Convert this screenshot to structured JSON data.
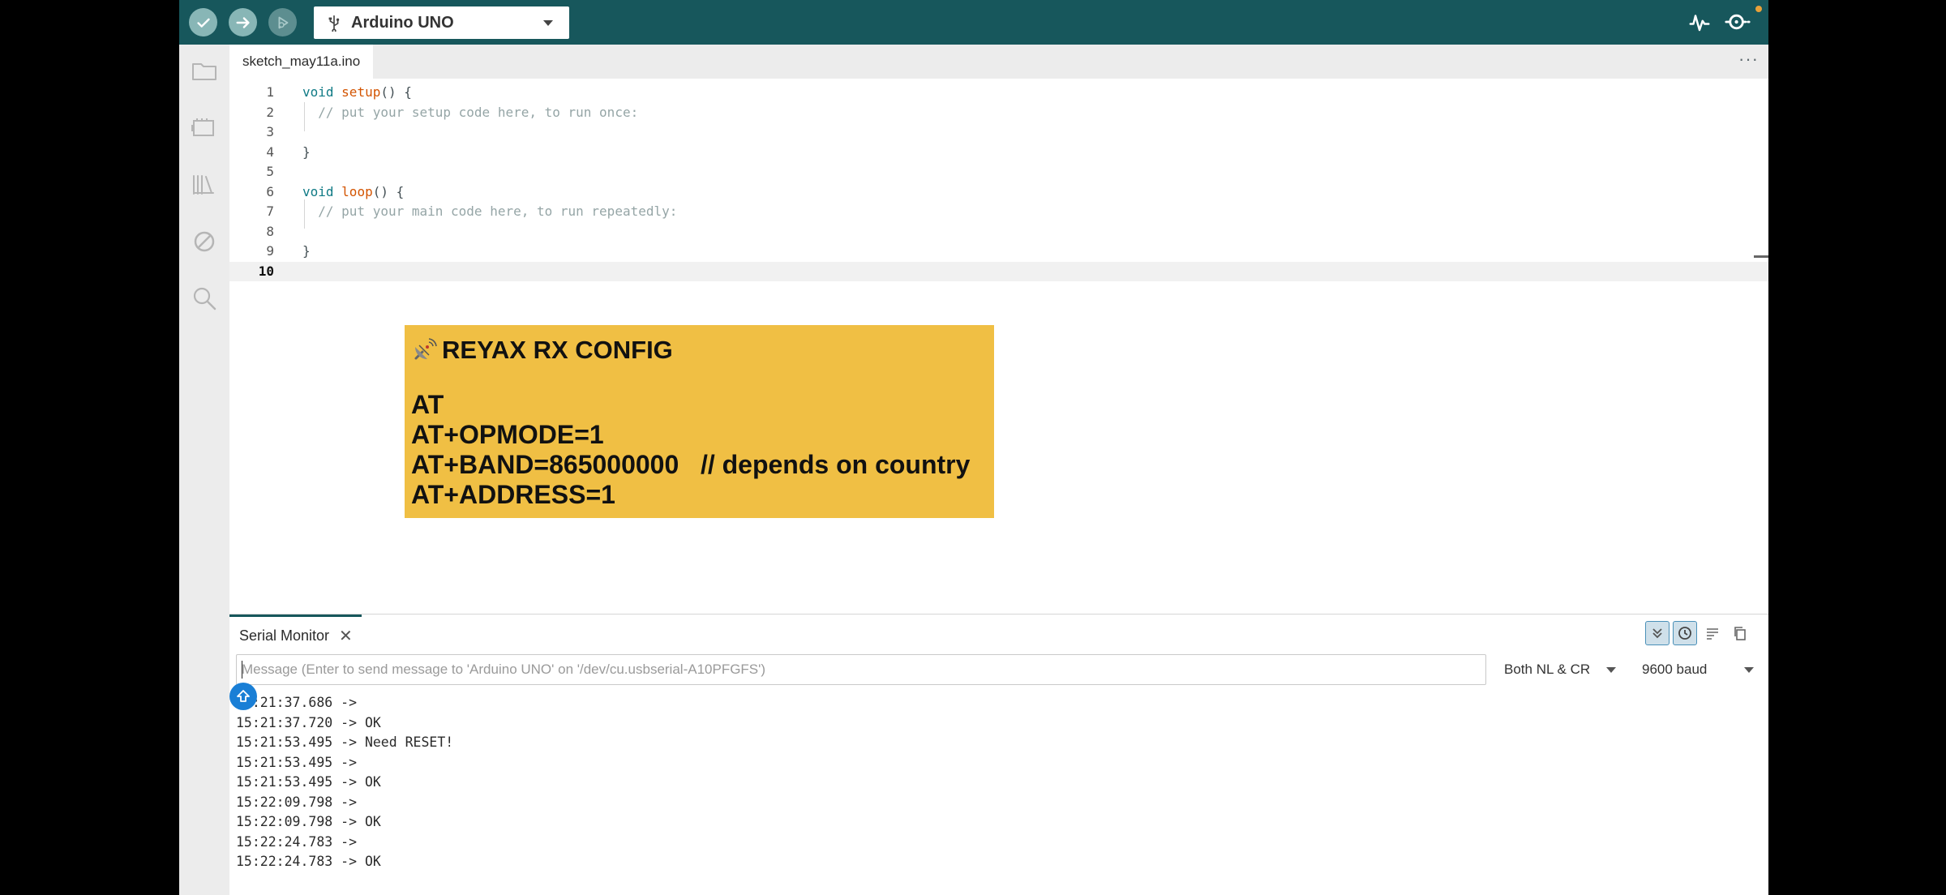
{
  "toolbar": {
    "board": "Arduino UNO",
    "verify_icon": "check-icon",
    "upload_icon": "arrow-right-icon",
    "debug_icon": "debug-icon",
    "plotter_icon": "serial-plotter-icon",
    "monitor_icon": "serial-monitor-icon",
    "colors": {
      "bar": "#17575c",
      "button": "#88b6b6",
      "notification": "#e8a13a"
    }
  },
  "sidebar": {
    "items": [
      "folder-icon",
      "boards-manager-icon",
      "library-icon",
      "debug-disabled-icon",
      "search-icon"
    ]
  },
  "tabs": {
    "file": "sketch_may11a.ino",
    "more": "···"
  },
  "editor": {
    "lines": [
      {
        "n": "1",
        "parts": [
          [
            "kw",
            "void"
          ],
          [
            "",
            " "
          ],
          [
            "fn",
            "setup"
          ],
          [
            "",
            "() {"
          ]
        ]
      },
      {
        "n": "2",
        "parts": [
          [
            "",
            "  "
          ],
          [
            "cm",
            "// put your setup code here, to run once:"
          ]
        ]
      },
      {
        "n": "3",
        "parts": []
      },
      {
        "n": "4",
        "parts": [
          [
            "",
            "}"
          ]
        ]
      },
      {
        "n": "5",
        "parts": []
      },
      {
        "n": "6",
        "parts": [
          [
            "kw",
            "void"
          ],
          [
            "",
            " "
          ],
          [
            "fn",
            "loop"
          ],
          [
            "",
            "() {"
          ]
        ]
      },
      {
        "n": "7",
        "parts": [
          [
            "",
            "  "
          ],
          [
            "cm",
            "// put your main code here, to run repeatedly:"
          ]
        ]
      },
      {
        "n": "8",
        "parts": []
      },
      {
        "n": "9",
        "parts": [
          [
            "",
            "}"
          ]
        ]
      },
      {
        "n": "10",
        "parts": []
      }
    ],
    "active_line": "10"
  },
  "overlay": {
    "icon": "satellite-antenna-icon",
    "title": "REYAX RX CONFIG",
    "commands": [
      "AT",
      "AT+OPMODE=1",
      "AT+BAND=865000000   // depends on country",
      "AT+ADDRESS=1"
    ],
    "background": "#f0bf44"
  },
  "serial": {
    "tab_label": "Serial Monitor",
    "close": "✕",
    "placeholder": "Message (Enter to send message to 'Arduino UNO' on '/dev/cu.usbserial-A10PFGFS')",
    "line_ending": "Both NL & CR",
    "baud": "9600 baud",
    "tools": [
      "autoscroll-icon",
      "timestamp-icon",
      "clear-output-icon",
      "copy-icon"
    ],
    "log": [
      "15:21:37.686 ->",
      "15:21:37.720 -> OK",
      "15:21:53.495 -> Need RESET!",
      "15:21:53.495 ->",
      "15:21:53.495 -> OK",
      "15:22:09.798 ->",
      "15:22:09.798 -> OK",
      "15:22:24.783 ->",
      "15:22:24.783 -> OK"
    ]
  }
}
